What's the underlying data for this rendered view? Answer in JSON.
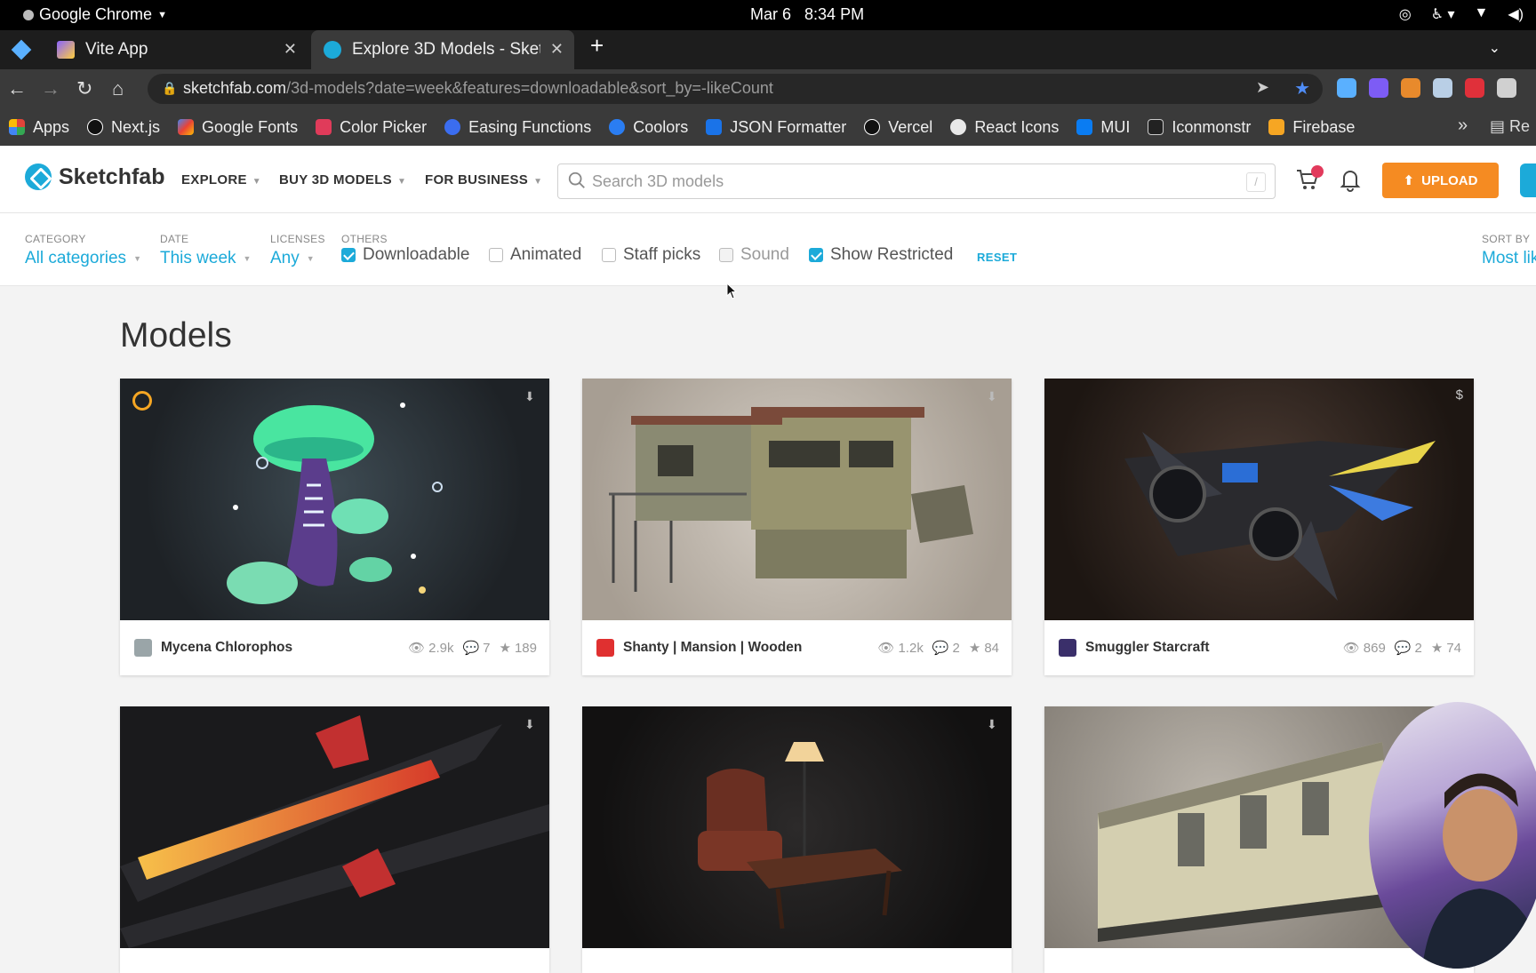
{
  "os": {
    "app_name": "Google Chrome",
    "date": "Mar 6",
    "time": "8:34 PM"
  },
  "browser": {
    "tabs": [
      {
        "title": "Vite App",
        "favicon_color": "#8a63ff"
      },
      {
        "title": "Explore 3D Models - Sketchfab",
        "favicon_color": "#1caad9",
        "active": true
      }
    ],
    "url_host": "sketchfab.com",
    "url_path": "/3d-models?date=week&features=downloadable&sort_by=-likeCount",
    "bookmarks": [
      {
        "label": "Apps",
        "color": "#e0443a"
      },
      {
        "label": "Next.js",
        "color": "#111111"
      },
      {
        "label": "Google Fonts",
        "color": "#4285f4"
      },
      {
        "label": "Color Picker",
        "color": "#e03b5a"
      },
      {
        "label": "Easing Functions",
        "color": "#3b6df0"
      },
      {
        "label": "Coolors",
        "color": "#2a7df2"
      },
      {
        "label": "JSON Formatter",
        "color": "#1a73e8"
      },
      {
        "label": "Vercel",
        "color": "#111111"
      },
      {
        "label": "React Icons",
        "color": "#e85d3a"
      },
      {
        "label": "MUI",
        "color": "#0a7cf2"
      },
      {
        "label": "Iconmonstr",
        "color": "#222222"
      },
      {
        "label": "Firebase",
        "color": "#f6a623"
      }
    ],
    "more_bookmarks": "»",
    "reading_list_label": "Re"
  },
  "header": {
    "logo_text": "Sketchfab",
    "nav": [
      "EXPLORE",
      "BUY 3D MODELS",
      "FOR BUSINESS"
    ],
    "search_placeholder": "Search 3D models",
    "search_shortcut": "/",
    "upload_label": "UPLOAD"
  },
  "filters": {
    "category": {
      "label": "CATEGORY",
      "value": "All categories"
    },
    "date": {
      "label": "DATE",
      "value": "This week"
    },
    "licenses": {
      "label": "LICENSES",
      "value": "Any"
    },
    "others_label": "OTHERS",
    "checkboxes": [
      {
        "label": "Downloadable",
        "checked": true
      },
      {
        "label": "Animated",
        "checked": false
      },
      {
        "label": "Staff picks",
        "checked": false
      },
      {
        "label": "Sound",
        "checked": false,
        "disabled": true
      },
      {
        "label": "Show Restricted",
        "checked": true
      }
    ],
    "reset_label": "RESET",
    "sort": {
      "label": "SORT BY",
      "value": "Most lik"
    }
  },
  "page_title": "Models",
  "models": [
    {
      "name": "Mycena Chlorophos",
      "views": "2.9k",
      "comments": "7",
      "likes": "189"
    },
    {
      "name": "Shanty | Mansion | Wooden",
      "views": "1.2k",
      "comments": "2",
      "likes": "84"
    },
    {
      "name": "Smuggler Starcraft",
      "views": "869",
      "comments": "2",
      "likes": "74",
      "price_icon": "$"
    }
  ],
  "colors": {
    "accent": "#1caad9",
    "upload": "#f58b22"
  }
}
